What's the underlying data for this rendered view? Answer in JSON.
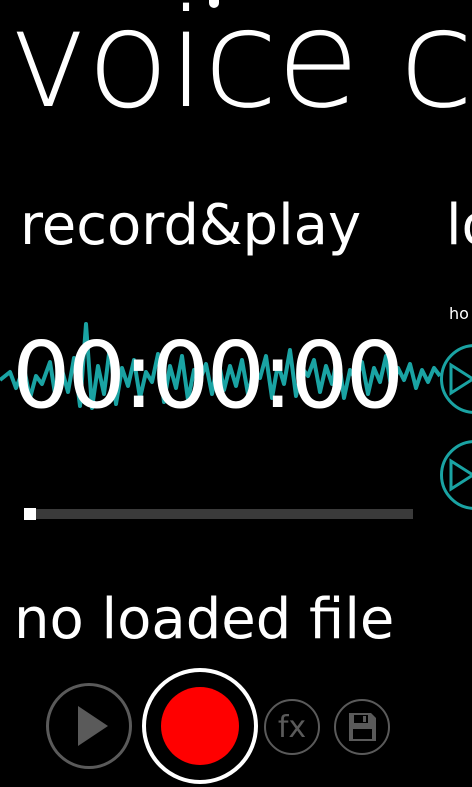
{
  "app": {
    "title": "voice",
    "title_peek": "c"
  },
  "pivot": {
    "current_label": "record&play",
    "next_label_peek": "lo",
    "next_panel_peek_text": "ho"
  },
  "player": {
    "timer": "00:00:00",
    "progress": 0.0,
    "status_text": "no loaded file"
  },
  "controls": {
    "play_icon": "play-icon",
    "record_icon": "record-icon",
    "effects_label": "fx",
    "save_icon": "floppy-disk-icon"
  },
  "colors": {
    "background": "#000000",
    "waveform": "#1aa3a3",
    "record": "#ff0000",
    "disabled": "#5a5a5a"
  }
}
